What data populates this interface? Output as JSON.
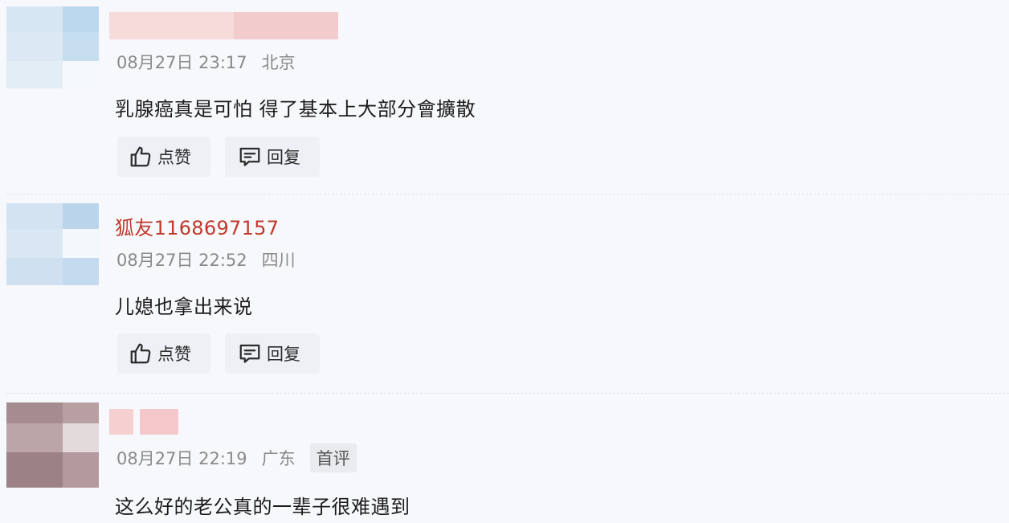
{
  "comments": [
    {
      "username": "",
      "date": "08月27日 23:17",
      "location": "北京",
      "badge": "",
      "text": "乳腺癌真是可怕 得了基本上大部分會擴散",
      "like_label": "点赞",
      "reply_label": "回复"
    },
    {
      "username": "狐友1168697157",
      "date": "08月27日 22:52",
      "location": "四川",
      "badge": "",
      "text": "儿媳也拿出来说",
      "like_label": "点赞",
      "reply_label": "回复"
    },
    {
      "username": "",
      "date": "08月27日 22:19",
      "location": "广东",
      "badge": "首评",
      "text": "这么好的老公真的一辈子很难遇到",
      "like_label": "",
      "reply_label": ""
    }
  ],
  "watermark": "",
  "colors": {
    "username": "#c0392b",
    "meta_text": "#8a8a8a",
    "button_bg": "#eef0f5",
    "page_bg": "#f7f8fc"
  },
  "icons": {
    "like": "thumbs-up-icon",
    "reply": "comment-icon"
  }
}
